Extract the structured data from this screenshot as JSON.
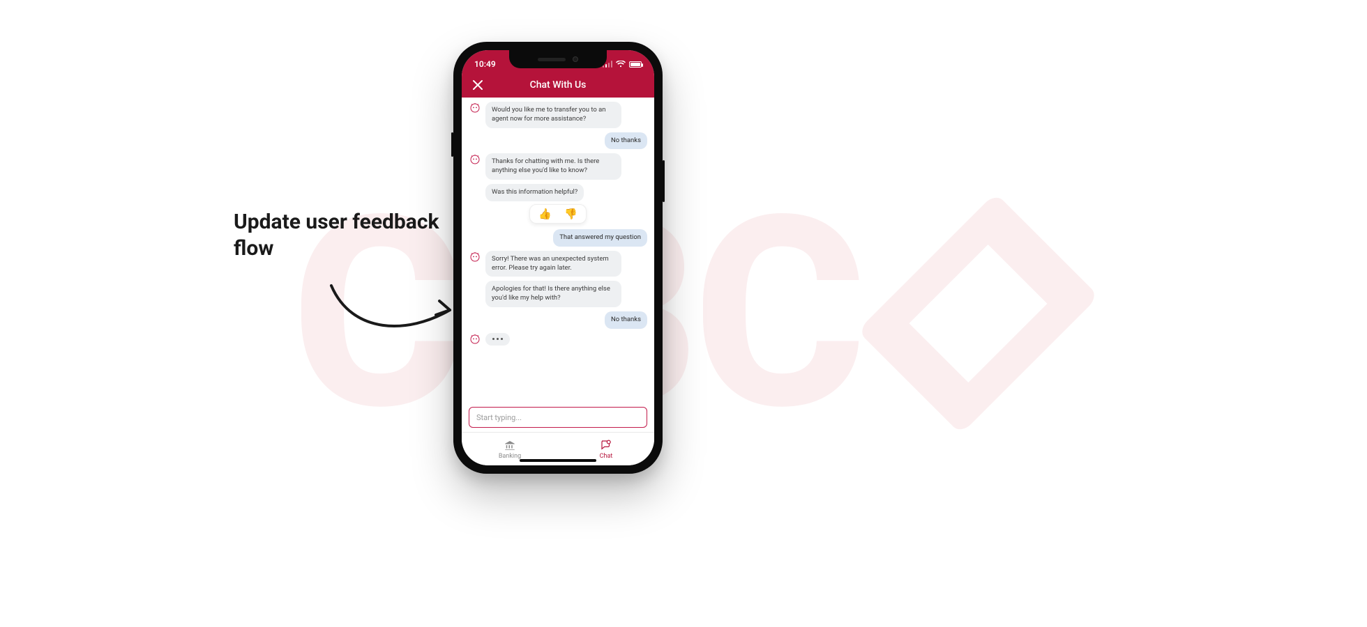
{
  "watermark": {
    "text": "CIBC"
  },
  "annotation": {
    "text": "Update user feedback flow"
  },
  "status": {
    "time": "10:49"
  },
  "header": {
    "title": "Chat With Us"
  },
  "messages": {
    "m0": "Would you like me to transfer you to an agent now for more assistance?",
    "m1": "No thanks",
    "m2": "Thanks for chatting with me. Is there anything else you'd like to know?",
    "m3": "Was this information helpful?",
    "m4": "That answered my question",
    "m5": "Sorry! There was an unexpected system error. Please try again later.",
    "m6": "Apologies for that! Is there anything else you'd like my help with?",
    "m7": "No thanks"
  },
  "reactions": {
    "up": "👍",
    "down": "👎"
  },
  "input": {
    "placeholder": "Start typing..."
  },
  "tabs": {
    "banking": "Banking",
    "chat": "Chat"
  }
}
